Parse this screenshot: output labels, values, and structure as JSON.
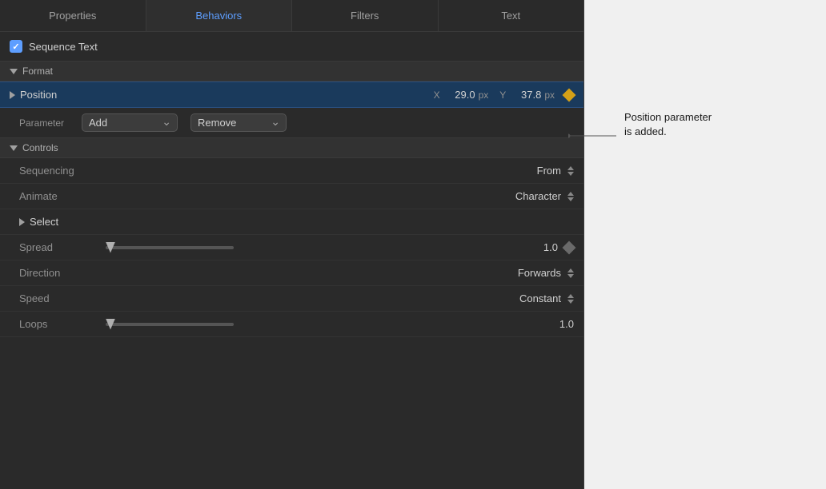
{
  "tabs": [
    {
      "id": "properties",
      "label": "Properties",
      "active": false
    },
    {
      "id": "behaviors",
      "label": "Behaviors",
      "active": true
    },
    {
      "id": "filters",
      "label": "Filters",
      "active": false
    },
    {
      "id": "text",
      "label": "Text",
      "active": false
    }
  ],
  "sequence_text": {
    "label": "Sequence Text",
    "checked": true
  },
  "format_section": {
    "label": "Format",
    "collapsed": false
  },
  "position": {
    "label": "Position",
    "x_label": "X",
    "x_value": "29.0",
    "x_unit": "px",
    "y_label": "Y",
    "y_value": "37.8",
    "y_unit": "px"
  },
  "parameter_row": {
    "label": "Parameter",
    "add_label": "Add",
    "remove_label": "Remove"
  },
  "controls_section": {
    "label": "Controls",
    "collapsed": false
  },
  "sequencing": {
    "label": "Sequencing",
    "value": "From"
  },
  "animate": {
    "label": "Animate",
    "value": "Character"
  },
  "select_section": {
    "label": "Select",
    "collapsed": true
  },
  "spread": {
    "label": "Spread",
    "value": "1.0",
    "thumb_position": 0
  },
  "direction": {
    "label": "Direction",
    "value": "Forwards"
  },
  "speed": {
    "label": "Speed",
    "value": "Constant"
  },
  "loops": {
    "label": "Loops",
    "value": "1.0",
    "thumb_position": 0
  },
  "annotation": {
    "line1": "Position parameter",
    "line2": "is added."
  }
}
